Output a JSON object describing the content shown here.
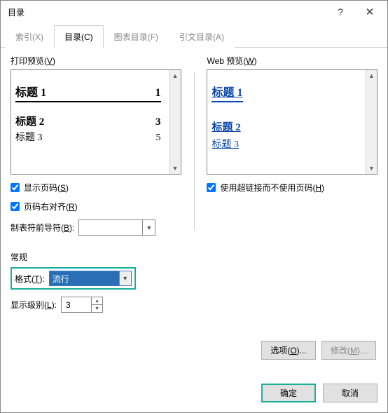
{
  "titlebar": {
    "title": "目录"
  },
  "tabs": {
    "index": "索引(X)",
    "toc": "目录(C)",
    "figures": "图表目录(F)",
    "authorities": "引文目录(A)"
  },
  "print_preview": {
    "label_pre": "打印预览(",
    "label_key": "V",
    "label_post": ")",
    "items": [
      {
        "title": "标题 1",
        "page": "1"
      },
      {
        "title": "标题 2",
        "page": "3"
      },
      {
        "title": "标题 3",
        "page": "5"
      }
    ]
  },
  "web_preview": {
    "label_pre": "Web 预览(",
    "label_key": "W",
    "label_post": ")",
    "items": [
      {
        "title": "标题 1"
      },
      {
        "title": "标题 2"
      },
      {
        "title": "标题 3"
      }
    ]
  },
  "options": {
    "show_page_pre": "显示页码(",
    "show_page_key": "S",
    "show_page_post": ")",
    "align_right_pre": "页码右对齐(",
    "align_right_key": "R",
    "align_right_post": ")",
    "leader_label_pre": "制表符前导符(",
    "leader_label_key": "B",
    "leader_label_post": "):",
    "leader_value": "",
    "hyperlinks_pre": "使用超链接而不使用页码(",
    "hyperlinks_key": "H",
    "hyperlinks_post": ")"
  },
  "general": {
    "label": "常规",
    "format_label_pre": "格式(",
    "format_label_key": "T",
    "format_label_post": "):",
    "format_value": "流行",
    "levels_label_pre": "显示级别(",
    "levels_label_key": "L",
    "levels_label_post": "):",
    "levels_value": "3"
  },
  "buttons": {
    "options_pre": "选项(",
    "options_key": "O",
    "options_post": ")...",
    "modify_pre": "修改(",
    "modify_key": "M",
    "modify_post": ")...",
    "ok": "确定",
    "cancel": "取消"
  }
}
